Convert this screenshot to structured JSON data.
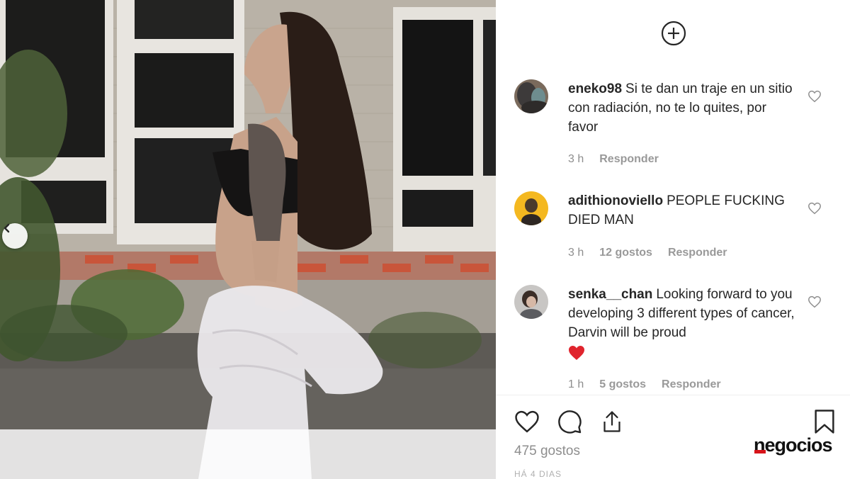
{
  "post": {
    "photo": {
      "icon_prev": "chevron-left-icon"
    }
  },
  "panel": {
    "new_post_icon": "plus-circle-icon",
    "comments": [
      {
        "username": "eneko98",
        "text": "Si te dan un traje en un sitio con radiación, no te lo quites, por favor",
        "time": "3 h",
        "likes": "",
        "reply": "Responder"
      },
      {
        "username": "adithionoviello",
        "text": "PEOPLE FUCKING DIED MAN",
        "time": "3 h",
        "likes": "12 gostos",
        "reply": "Responder"
      },
      {
        "username": "senka__chan",
        "text": "Looking forward to you developing 3 different types of cancer, Darvin will be proud",
        "emoji": "red-heart-emoji",
        "time": "1 h",
        "likes": "5 gostos",
        "reply": "Responder"
      }
    ],
    "actions": {
      "like_icon": "heart-icon",
      "comment_icon": "comment-icon",
      "share_icon": "share-icon",
      "save_icon": "bookmark-icon"
    },
    "likes_count": "475 gostos",
    "date": "HÁ 4 DIAS"
  },
  "watermark": {
    "text": "negocios",
    "accent_color": "#d7141a"
  },
  "colors": {
    "text": "#262626",
    "meta": "#8e8e8e",
    "heart_red": "#ed4956"
  }
}
